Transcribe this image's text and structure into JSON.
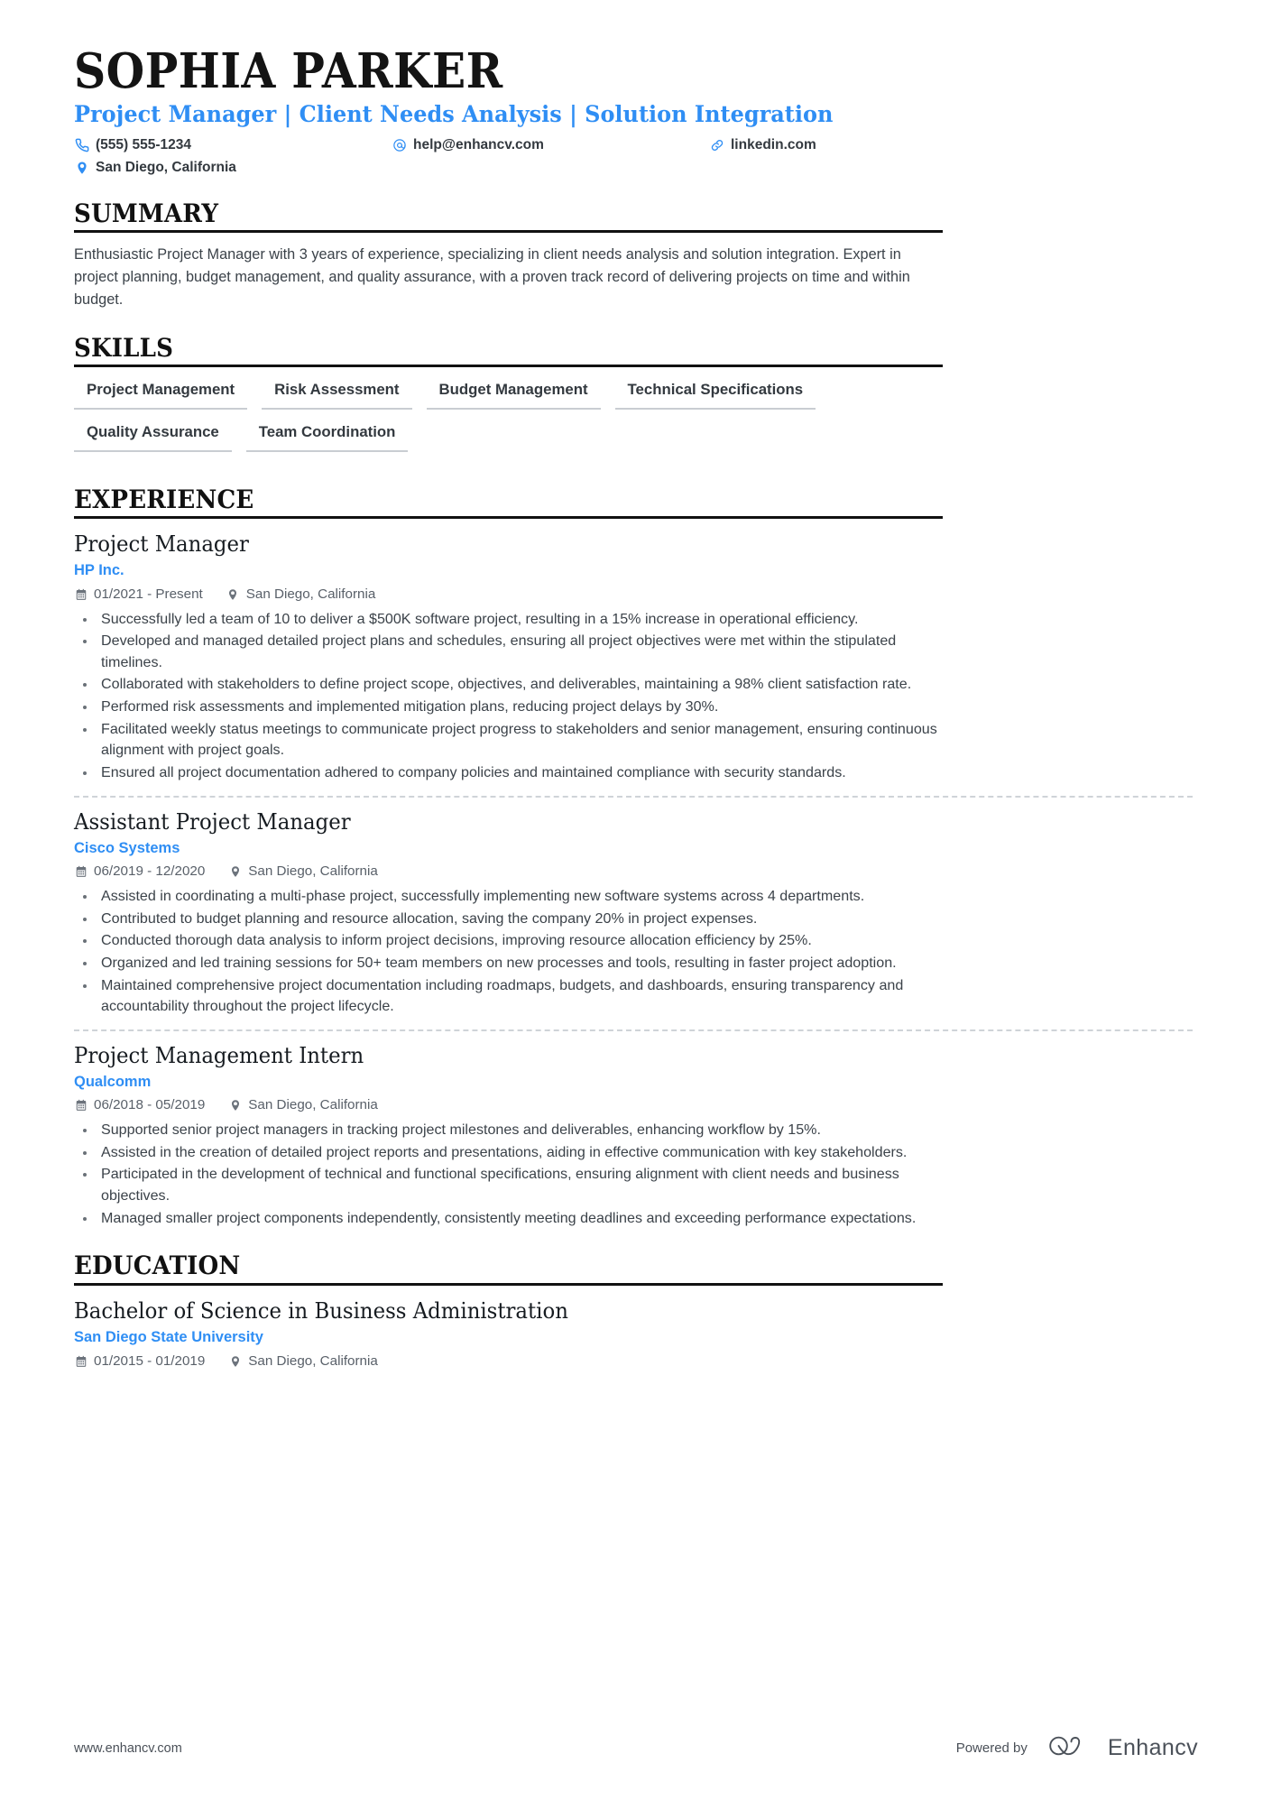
{
  "header": {
    "name": "SOPHIA PARKER",
    "headline": "Project Manager | Client Needs Analysis | Solution Integration",
    "contacts": [
      {
        "icon": "phone-icon",
        "label": "(555) 555-1234"
      },
      {
        "icon": "email-icon",
        "label": "help@enhancv.com"
      },
      {
        "icon": "link-icon",
        "label": "linkedin.com"
      },
      {
        "icon": "location-icon",
        "label": "San Diego, California"
      }
    ]
  },
  "summary": {
    "title": "SUMMARY",
    "text": "Enthusiastic Project Manager with 3 years of experience, specializing in client needs analysis and solution integration. Expert in project planning, budget management, and quality assurance, with a proven track record of delivering projects on time and within budget."
  },
  "skills": {
    "title": "SKILLS",
    "items": [
      "Project Management",
      "Risk Assessment",
      "Budget Management",
      "Technical Specifications",
      "Quality Assurance",
      "Team Coordination"
    ]
  },
  "experience": {
    "title": "EXPERIENCE",
    "entries": [
      {
        "role": "Project Manager",
        "company": "HP Inc.",
        "dates": "01/2021 - Present",
        "location": "San Diego, California",
        "bullets": [
          "Successfully led a team of 10 to deliver a $500K software project, resulting in a 15% increase in operational efficiency.",
          "Developed and managed detailed project plans and schedules, ensuring all project objectives were met within the stipulated timelines.",
          "Collaborated with stakeholders to define project scope, objectives, and deliverables, maintaining a 98% client satisfaction rate.",
          "Performed risk assessments and implemented mitigation plans, reducing project delays by 30%.",
          "Facilitated weekly status meetings to communicate project progress to stakeholders and senior management, ensuring continuous alignment with project goals.",
          "Ensured all project documentation adhered to company policies and maintained compliance with security standards."
        ]
      },
      {
        "role": "Assistant Project Manager",
        "company": "Cisco Systems",
        "dates": "06/2019 - 12/2020",
        "location": "San Diego, California",
        "bullets": [
          "Assisted in coordinating a multi-phase project, successfully implementing new software systems across 4 departments.",
          "Contributed to budget planning and resource allocation, saving the company 20% in project expenses.",
          "Conducted thorough data analysis to inform project decisions, improving resource allocation efficiency by 25%.",
          "Organized and led training sessions for 50+ team members on new processes and tools, resulting in faster project adoption.",
          "Maintained comprehensive project documentation including roadmaps, budgets, and dashboards, ensuring transparency and accountability throughout the project lifecycle."
        ]
      },
      {
        "role": "Project Management Intern",
        "company": "Qualcomm",
        "dates": "06/2018 - 05/2019",
        "location": "San Diego, California",
        "bullets": [
          "Supported senior project managers in tracking project milestones and deliverables, enhancing workflow by 15%.",
          "Assisted in the creation of detailed project reports and presentations, aiding in effective communication with key stakeholders.",
          "Participated in the development of technical and functional specifications, ensuring alignment with client needs and business objectives.",
          "Managed smaller project components independently, consistently meeting deadlines and exceeding performance expectations."
        ]
      }
    ]
  },
  "education": {
    "title": "EDUCATION",
    "entries": [
      {
        "degree": "Bachelor of Science in Business Administration",
        "school": "San Diego State University",
        "dates": "01/2015 - 01/2019",
        "location": "San Diego, California"
      }
    ]
  },
  "footer": {
    "url": "www.enhancv.com",
    "powered_by": "Powered by",
    "brand": "Enhancv"
  },
  "colors": {
    "accent": "#2f8ef4",
    "text": "#33393f",
    "muted": "#596069",
    "rule": "#111111",
    "chip_underline": "#c9cdd2"
  }
}
